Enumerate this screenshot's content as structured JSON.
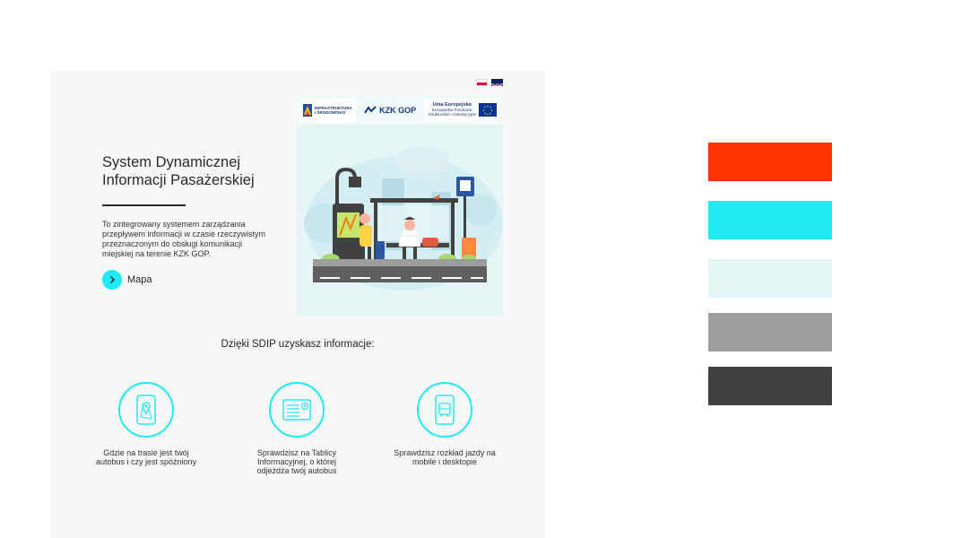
{
  "hero": {
    "title": "System Dynamicznej Informacji Pasażerskiej",
    "description": "To zintegrowany systemem zarządzania przepływem informacji w czasie rzeczywistym przeznaczonym do obsługi komunikacji miejskiej na terenie KZK GOP.",
    "map_label": "Mapa"
  },
  "logos": {
    "infrastruktura_line1": "INFRASTRUKTURA",
    "infrastruktura_line2": "I ŚRODOWISKO",
    "kzk": "KZK GOP",
    "eu_title": "Unia Europejska",
    "eu_sub1": "Europejskie Fundusze",
    "eu_sub2": "Strukturalne i Inwestycyjne"
  },
  "features": {
    "heading": "Dzięki SDIP uzyskasz informacje:",
    "items": [
      {
        "text": "Gdzie na trasie jest twój autobus i czy jest spóźniony",
        "icon": "phone-map-pin-icon"
      },
      {
        "text": "Sprawdzisz na Tablicy Informacyjnej, o której odjeżdża twój autobus",
        "icon": "info-board-icon"
      },
      {
        "text": "Sprawdzisz rozkład jazdy na mobile i desktopie",
        "icon": "phone-bus-icon"
      }
    ]
  },
  "palette": [
    "#ff3300",
    "#1fe9f3",
    "#e6f6f6",
    "#9d9e9b",
    "#40423f"
  ],
  "colors": {
    "accent": "#1fe9f3",
    "panel": "#f8f8f8",
    "text": "#2a2a2a"
  }
}
